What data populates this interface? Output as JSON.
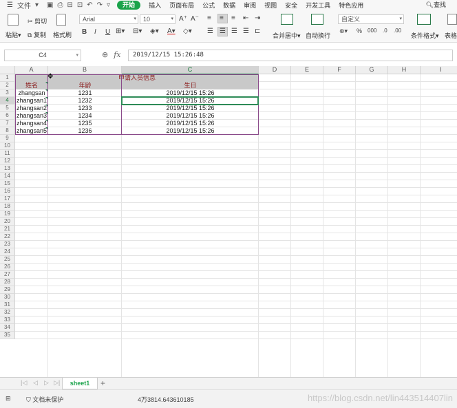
{
  "menubar": {
    "file": "文件",
    "tabs": [
      "开始",
      "插入",
      "页面布局",
      "公式",
      "数据",
      "审阅",
      "视图",
      "安全",
      "开发工具",
      "特色应用"
    ],
    "search": "查找"
  },
  "ribbon": {
    "paste": "粘贴",
    "cut": "剪切",
    "copy": "复制",
    "format_painter": "格式刷",
    "font_name": "Arial",
    "font_size": "10",
    "merge_center": "合并居中",
    "wrap_text": "自动换行",
    "number_format": "自定义",
    "conditional_format": "条件格式",
    "table_style": "表格"
  },
  "formula_bar": {
    "cell_ref": "C4",
    "fx_label": "fx",
    "value": "2019/12/15  15:26:48"
  },
  "grid": {
    "columns": [
      "A",
      "B",
      "C",
      "D",
      "E",
      "F",
      "G",
      "H",
      "I"
    ],
    "title": "申请人员信息",
    "headers": [
      "姓名",
      "年龄",
      "生日"
    ],
    "rows": [
      [
        "zhangsan",
        "1231",
        "2019/12/15 15:26"
      ],
      [
        "zhangsan1",
        "1232",
        "2019/12/15 15:26"
      ],
      [
        "zhangsan2",
        "1233",
        "2019/12/15 15:26"
      ],
      [
        "zhangsan3",
        "1234",
        "2019/12/15 15:26"
      ],
      [
        "zhangsan4",
        "1235",
        "2019/12/15 15:26"
      ],
      [
        "zhangsan5",
        "1236",
        "2019/12/15 15:26"
      ]
    ],
    "row_numbers": [
      "1",
      "2",
      "3",
      "4",
      "5",
      "6",
      "7",
      "8",
      "9",
      "10",
      "11",
      "12",
      "13",
      "14",
      "15",
      "16",
      "17",
      "18",
      "19",
      "20",
      "21",
      "22",
      "23",
      "24",
      "25",
      "26",
      "27",
      "28",
      "29",
      "30",
      "31",
      "32",
      "33",
      "34",
      "35"
    ],
    "selected_row": "4",
    "selected_col": "C"
  },
  "sheets": {
    "tabs": [
      "sheet1"
    ],
    "add": "+"
  },
  "status": {
    "doc_protect": "文档未保护",
    "value": "4万3814.643610185",
    "watermark": "https://blog.csdn.net/lin443514407lin"
  },
  "colors": {
    "accent": "#1aa34a",
    "header_fill": "#c9c9c9",
    "header_text": "#8b1a1a",
    "active_border": "#2e8b57"
  }
}
